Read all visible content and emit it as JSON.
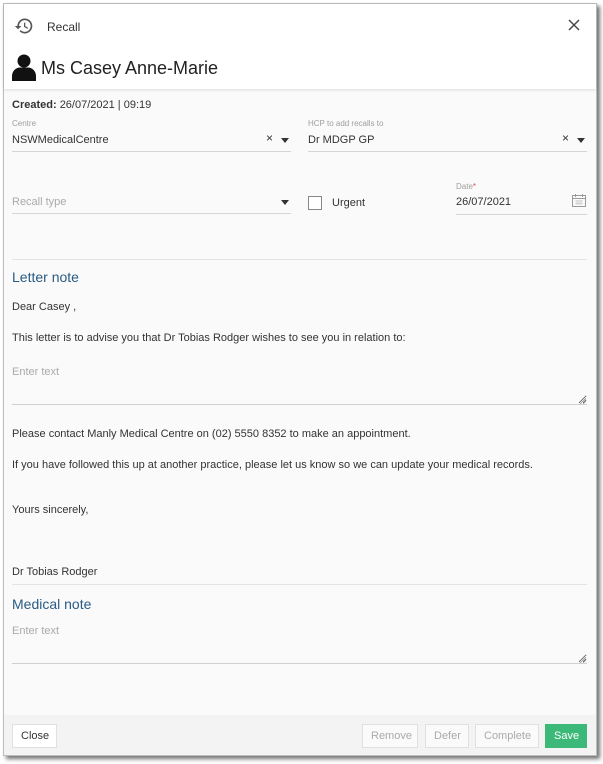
{
  "dialog": {
    "title": "Recall",
    "patient_name": "Ms Casey Anne-Marie",
    "created_label": "Created:",
    "created_value": "26/07/2021 | 09:19"
  },
  "form": {
    "centre": {
      "label": "Centre",
      "value": "NSWMedicalCentre"
    },
    "hcp": {
      "label": "HCP to add recalls to",
      "value": "Dr MDGP GP"
    },
    "recall_type": {
      "placeholder": "Recall type"
    },
    "urgent": {
      "label": "Urgent",
      "checked": false
    },
    "date": {
      "label": "Date",
      "required_mark": "*",
      "value": "26/07/2021"
    }
  },
  "letter": {
    "title": "Letter note",
    "greeting": "Dear Casey ,",
    "intro": "This letter is to advise you that Dr Tobias Rodger wishes to see you in relation to:",
    "input_placeholder": "Enter text",
    "contact": "Please contact Manly Medical Centre on (02) 5550 8352 to make an appointment.",
    "followup": "If you have followed this up at another practice, please let us know so we can update your medical records.",
    "closing": "Yours sincerely,",
    "signature": "Dr Tobias Rodger"
  },
  "medical": {
    "title": "Medical note",
    "input_placeholder": "Enter text"
  },
  "footer": {
    "close": "Close",
    "remove": "Remove",
    "defer": "Defer",
    "complete": "Complete",
    "save": "Save"
  },
  "icons": {
    "clear": "×"
  },
  "colors": {
    "accent_heading": "#2a5b84",
    "save_button": "#3cb878"
  }
}
